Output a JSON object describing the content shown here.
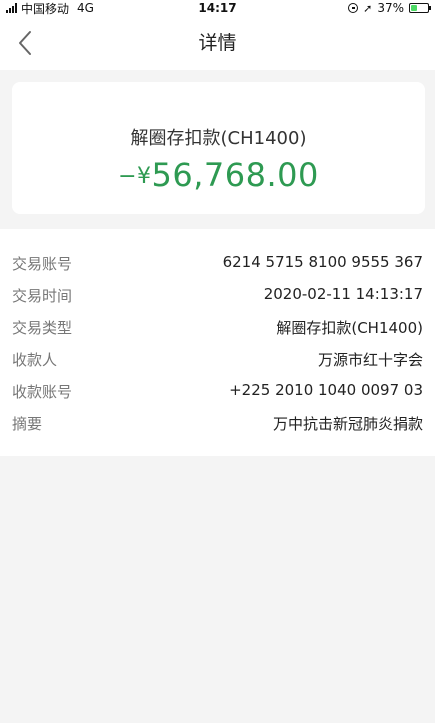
{
  "status_bar": {
    "carrier": "中国移动",
    "network": "4G",
    "time": "14:17",
    "battery_percent": "37%",
    "battery_level": 0.37
  },
  "nav": {
    "title": "详情",
    "back_icon": "chevron-left-icon"
  },
  "summary": {
    "title": "解圈存扣款(CH1400)",
    "amount_prefix": "−¥",
    "amount_value": "56,768.00",
    "amount_color": "#2e9a52"
  },
  "details": [
    {
      "label": "交易账号",
      "value": "6214 5715 8100 9555 367"
    },
    {
      "label": "交易时间",
      "value": "2020-02-11 14:13:17"
    },
    {
      "label": "交易类型",
      "value": "解圈存扣款(CH1400)"
    },
    {
      "label": "收款人",
      "value": "万源市红十字会"
    },
    {
      "label": "收款账号",
      "value": "+225 2010 1040 0097 03"
    },
    {
      "label": "摘要",
      "value": "万中抗击新冠肺炎捐款"
    }
  ]
}
